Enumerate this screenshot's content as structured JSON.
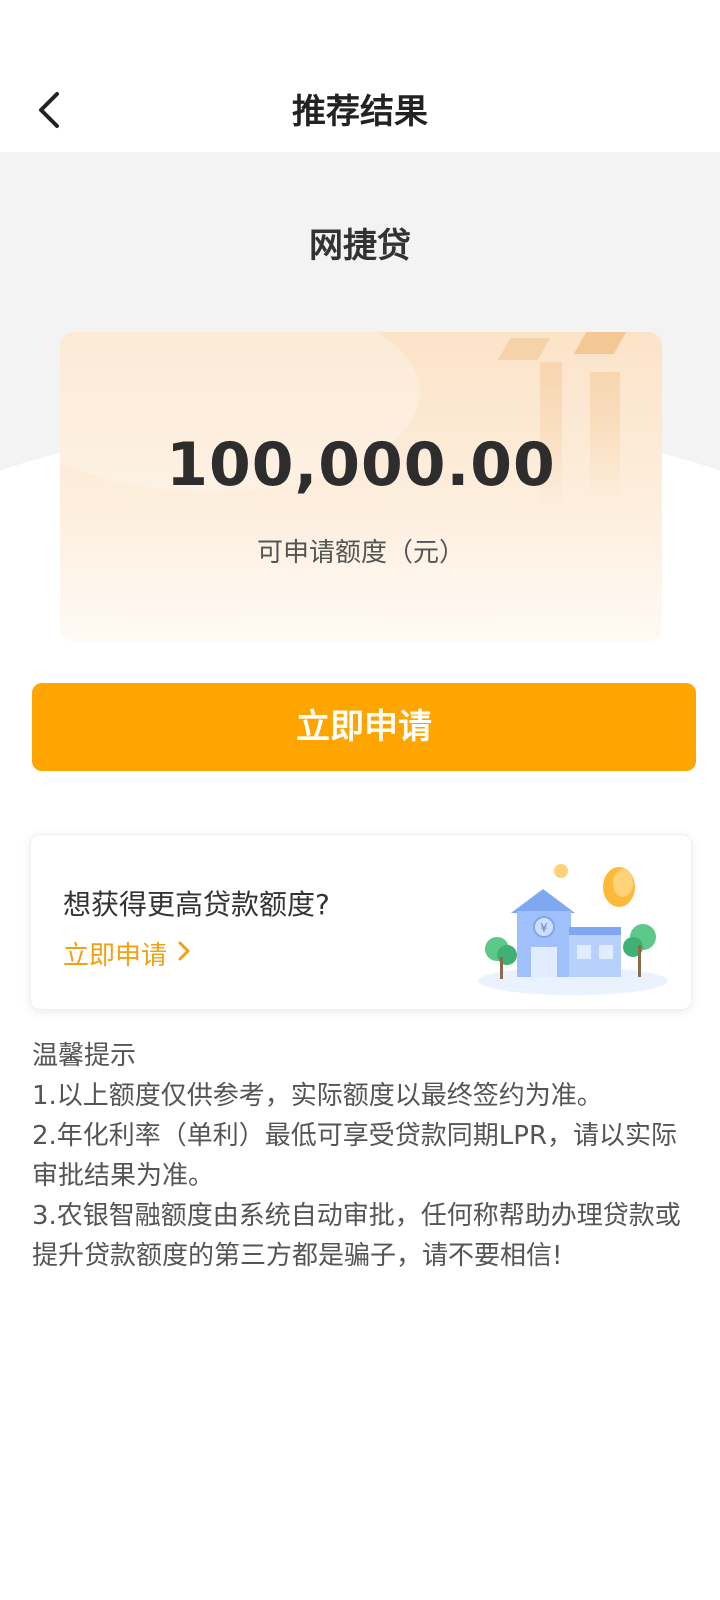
{
  "header": {
    "title": "推荐结果",
    "back_icon": "chevron-left-icon"
  },
  "product": {
    "name": "网捷贷"
  },
  "quota": {
    "amount": "100,000.00",
    "label": "可申请额度（元）"
  },
  "apply_button": {
    "label": "立即申请",
    "color": "#ffa500"
  },
  "promo": {
    "title": "想获得更高贷款额度?",
    "link_label": "立即申请",
    "link_color": "#f2a113",
    "illustration": "bank-building-illustration"
  },
  "tips": {
    "title": "温馨提示",
    "items": [
      "1.以上额度仅供参考，实际额度以最终签约为准。",
      "2.年化利率（单利）最低可享受贷款同期LPR，请以实际审批结果为准。",
      "3.农银智融额度由系统自动审批，任何称帮助办理贷款或提升贷款额度的第三方都是骗子，请不要相信!"
    ]
  }
}
